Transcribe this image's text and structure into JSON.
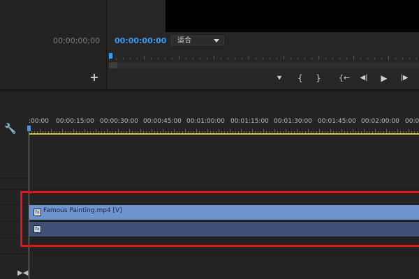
{
  "source_monitor": {
    "timecode": "00;00;00;00",
    "add_label": "+"
  },
  "program_monitor": {
    "timecode": "00:00:00:00",
    "fit_select": "适合",
    "controls": {
      "marker": "⯆",
      "mark_in": "{",
      "mark_out": "}",
      "go_to_in": "{←",
      "step_back": "◀|",
      "play": "▶",
      "step_forward": "|▶"
    }
  },
  "timeline": {
    "ruler_labels": [
      ":00:00",
      "00:00:15:00",
      "00:00:30:00",
      "00:00:45:00",
      "00:01:00:00",
      "00:01:15:00",
      "00:01:30:00",
      "00:01:45:00",
      "00:02:00:00",
      "00:02"
    ],
    "video_clip": {
      "name": "Famous Painting.mp4 [V]",
      "fx": "fx"
    },
    "audio_clip": {
      "fx": "fx"
    }
  },
  "colors": {
    "playhead": "#3a9bf0",
    "video_clip": "#6f93cf",
    "audio_clip": "#3e5076",
    "work_area": "#d5c23a",
    "highlight": "#e3151b"
  }
}
